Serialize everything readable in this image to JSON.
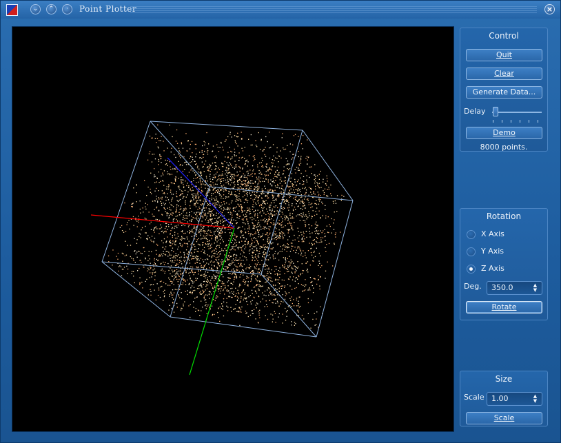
{
  "window": {
    "title": "Point  Plotter",
    "icons": [
      "app-icon",
      "minimize-icon",
      "maximize-icon",
      "sticky-icon",
      "close-icon"
    ]
  },
  "control": {
    "title": "Control",
    "quit": "Quit",
    "clear": "Clear",
    "generate": "Generate Data...",
    "delay_label": "Delay",
    "delay_value": 0.0,
    "demo": "Demo",
    "points": "8000 points."
  },
  "rotation": {
    "title": "Rotation",
    "x_axis": "X Axis",
    "y_axis": "Y Axis",
    "z_axis": "Z Axis",
    "selected": "Z Axis",
    "deg_label": "Deg.",
    "deg_value": "350.0",
    "rotate": "Rotate"
  },
  "size": {
    "title": "Size",
    "scale_label": "Scale",
    "scale_value": "1.00",
    "scale_button": "Scale"
  },
  "colors": {
    "axis_x": "#ff0000",
    "axis_y": "#00e000",
    "axis_z": "#2020ff",
    "box": "#8fb3e0",
    "points": "#ffdca0"
  }
}
